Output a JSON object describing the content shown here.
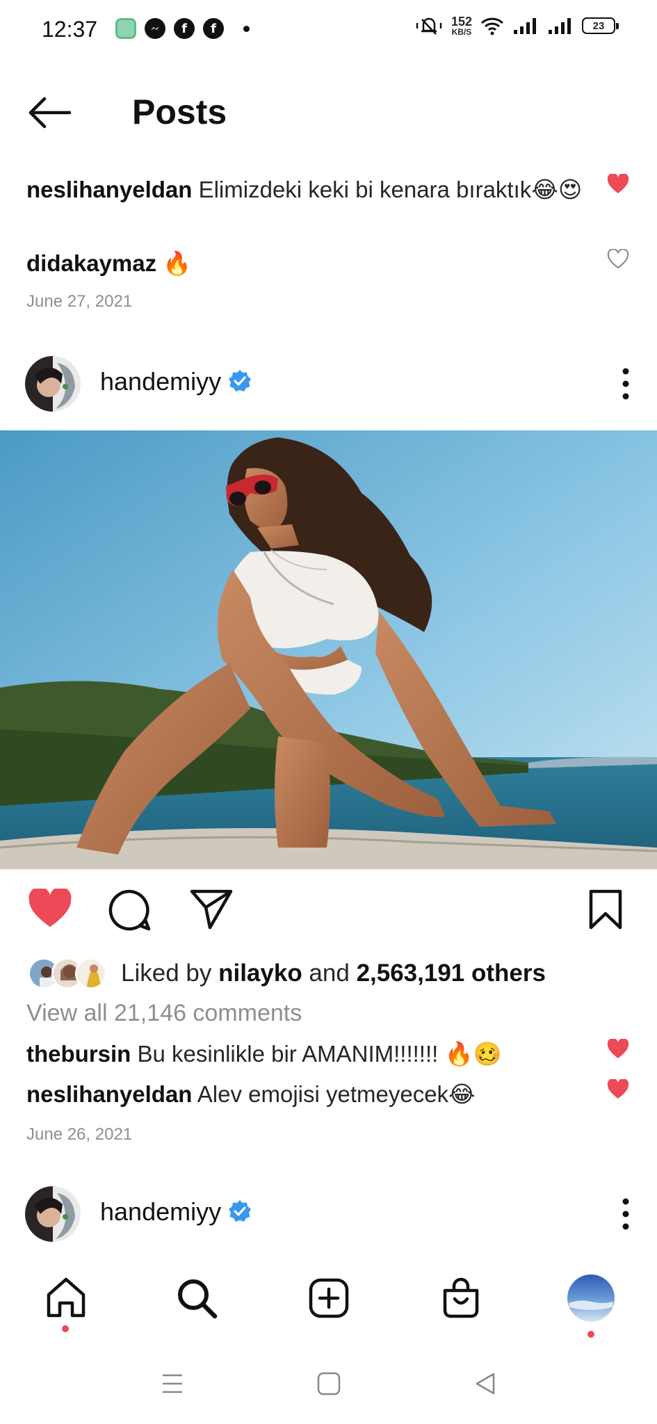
{
  "status_bar": {
    "time": "12:37",
    "net_speed_value": "152",
    "net_speed_unit": "KB/S",
    "battery": "23",
    "app_icons": [
      "chat-bubble-icon",
      "messenger-icon",
      "facebook-icon",
      "facebook-icon"
    ]
  },
  "header": {
    "title": "Posts"
  },
  "previous_post": {
    "comments": [
      {
        "user": "neslihanyeldan",
        "text": " Elimizdeki keki bi kenara bıraktık😂😍",
        "liked": true
      },
      {
        "user": "didakaymaz",
        "text": " 🔥",
        "liked": false
      }
    ],
    "date": "June 27, 2021"
  },
  "post": {
    "username": "handemiyy",
    "verified": true,
    "liked": true,
    "likes": {
      "prefix": "Liked by ",
      "first_user": "nilayko",
      "middle": " and ",
      "count": "2,563,191 others"
    },
    "view_all": "View all 21,146 comments",
    "comments": [
      {
        "user": "thebursin",
        "text": " Bu kesinlikle bir AMANIM!!!!!!! 🔥🥴",
        "liked": true
      },
      {
        "user": "neslihanyeldan",
        "text": " Alev emojisi yetmeyecek😂",
        "liked": true
      }
    ],
    "date": "June 26, 2021"
  },
  "next_post": {
    "username": "handemiyy",
    "verified": true
  },
  "colors": {
    "like_red": "#ed4956",
    "verified_blue": "#3897f0",
    "muted_text": "#8e8e8e"
  }
}
